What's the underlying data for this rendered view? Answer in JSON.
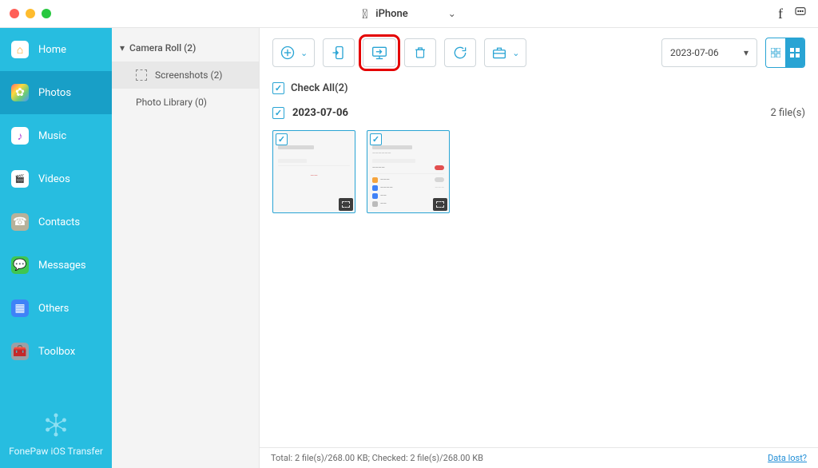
{
  "topbar": {
    "device_name": "iPhone"
  },
  "sidebar": {
    "items": [
      {
        "label": "Home"
      },
      {
        "label": "Photos"
      },
      {
        "label": "Music"
      },
      {
        "label": "Videos"
      },
      {
        "label": "Contacts"
      },
      {
        "label": "Messages"
      },
      {
        "label": "Others"
      },
      {
        "label": "Toolbox"
      }
    ],
    "brand": "FonePaw iOS Transfer"
  },
  "subcolumn": {
    "camera_roll": "Camera Roll (2)",
    "screenshots": "Screenshots (2)",
    "photo_library": "Photo Library (0)"
  },
  "toolbar": {
    "date": "2023-07-06"
  },
  "main": {
    "check_all_label": "Check All(2)",
    "group_date": "2023-07-06",
    "group_count": "2 file(s)"
  },
  "status": {
    "text": "Total: 2 file(s)/268.00 KB; Checked: 2 file(s)/268.00 KB",
    "link": "Data lost?"
  }
}
